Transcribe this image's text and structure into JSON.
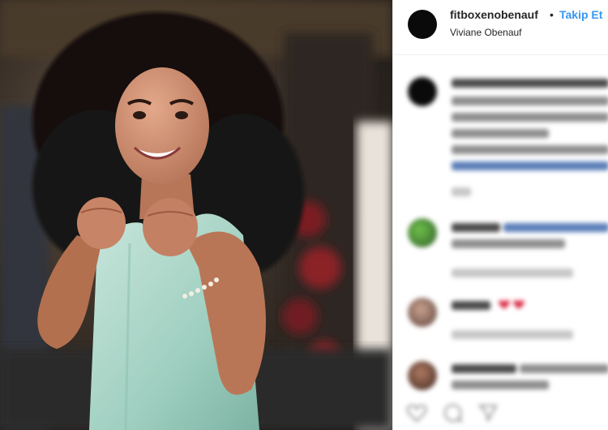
{
  "post": {
    "username": "fitboxenobenauf",
    "separator": "•",
    "follow_label": "Takip Et",
    "location": "Viviane Obenauf"
  },
  "colors": {
    "follow_blue": "#3897f0",
    "text_dark": "#262626",
    "border": "#efefef"
  },
  "icons": {
    "like": "heart-icon",
    "comment": "comment-icon",
    "share": "share-icon"
  }
}
